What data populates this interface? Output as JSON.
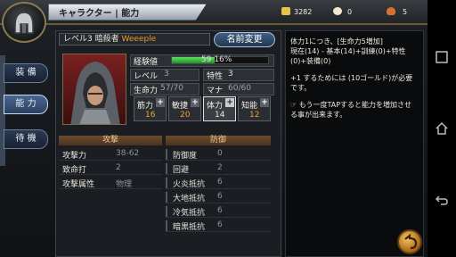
{
  "header": {
    "title": "キャラクター | 能力",
    "gold": "3282",
    "gem": "0",
    "potion": "5"
  },
  "nav": {
    "items": [
      {
        "label": "装 備"
      },
      {
        "label": "能 力"
      },
      {
        "label": "待 機"
      }
    ]
  },
  "profile": {
    "level_text": "レベル3 暗殺者",
    "name": "Weeeple",
    "rename_label": "名前変更",
    "xp_label": "経験値",
    "xp_text": "59 16%",
    "xp_fraction": 0.16,
    "level_label": "レベル",
    "level_value": "3",
    "trait_label": "特性",
    "trait_value": "3",
    "hp_label": "生命力",
    "hp_value": "57/70",
    "mana_label": "マナ",
    "mana_value": "60/60"
  },
  "stats": [
    {
      "label": "筋力",
      "value": "16"
    },
    {
      "label": "敏捷",
      "value": "20"
    },
    {
      "label": "体力",
      "value": "14"
    },
    {
      "label": "知能",
      "value": "12"
    }
  ],
  "attack": {
    "header": "攻撃",
    "rows": [
      {
        "label": "攻撃力",
        "value": "38-62"
      },
      {
        "label": "致命打",
        "value": "2"
      },
      {
        "label": "攻撃属性",
        "value": "物理"
      }
    ]
  },
  "defense": {
    "header": "防御",
    "rows": [
      {
        "label": "防御度",
        "value": "0"
      },
      {
        "label": "回避",
        "value": "2"
      },
      {
        "label": "火炎抵抗",
        "value": "6"
      },
      {
        "label": "大地抵抗",
        "value": "6"
      },
      {
        "label": "冷気抵抗",
        "value": "6"
      },
      {
        "label": "暗黒抵抗",
        "value": "6"
      }
    ]
  },
  "description": {
    "p1": "体力1につき、[生命力5増加]\n現在(14) - 基本(14)+訓練(0)+特性(0)+装備(0)",
    "p2": "+1 するためには (10ゴールド)が必要です。",
    "p3": "☞ もう一度TAPすると能力を増加させる事が出来ます。"
  },
  "icons": [
    "helmet-icon",
    "gold-icon",
    "gem-icon",
    "potion-icon",
    "back-icon",
    "square-icon",
    "home-icon",
    "android-back-icon"
  ],
  "colors": {
    "accent_orange": "#f0a12c",
    "xp_green": "#3fbf44",
    "nav_blue": "#2a4062"
  }
}
